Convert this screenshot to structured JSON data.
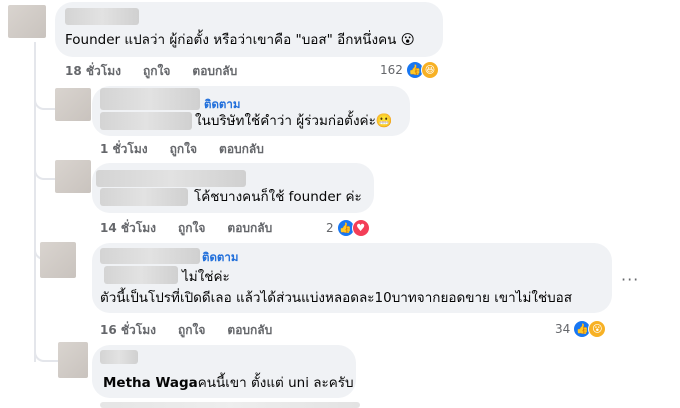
{
  "comments": [
    {
      "text": "Founder แปลว่า ผู้ก่อตั้ง หรือว่าเขาคือ \"บอส\" อีกหนึ่งคน",
      "emoji": "😮",
      "time": "18 ชั่วโมง",
      "like": "ถูกใจ",
      "reply": "ตอบกลับ",
      "count": "162",
      "reactions": [
        "like-icon",
        "haha-icon"
      ]
    },
    {
      "follow": "ติดตาม",
      "text": "ในบริษัทใช้คำว่า ผู้ร่วมก่อตั้งค่ะ",
      "emoji": "😬",
      "time": "1 ชั่วโมง",
      "like": "ถูกใจ",
      "reply": "ตอบกลับ"
    },
    {
      "text": "โค้ชบางคนก็ใช้ founder ค่ะ",
      "time": "14 ชั่วโมง",
      "like": "ถูกใจ",
      "reply": "ตอบกลับ",
      "count": "2",
      "reactions": [
        "like-icon",
        "love-icon"
      ]
    },
    {
      "follow": "ติดตาม",
      "text1": "ไม่ใช่ค่ะ",
      "text2": "ตัวนี้เป็นโปรที่เปิดดีเลอ แล้วได้ส่วนแบ่งหลอดละ10บาทจากยอดขาย เขาไม่ใช่บอส",
      "time": "16 ชั่วโมง",
      "like": "ถูกใจ",
      "reply": "ตอบกลับ",
      "count": "34",
      "reactions": [
        "like-icon",
        "wow-icon"
      ],
      "more": "···"
    },
    {
      "name": "Metha Waga",
      "text": "คนนี้เขา ตั้งแต่ uni ละครับ"
    }
  ],
  "colors": {
    "bubble": "#f0f2f5",
    "link": "#216fdb",
    "meta": "#65676b",
    "like": "#1877f2",
    "love": "#f33e58"
  }
}
